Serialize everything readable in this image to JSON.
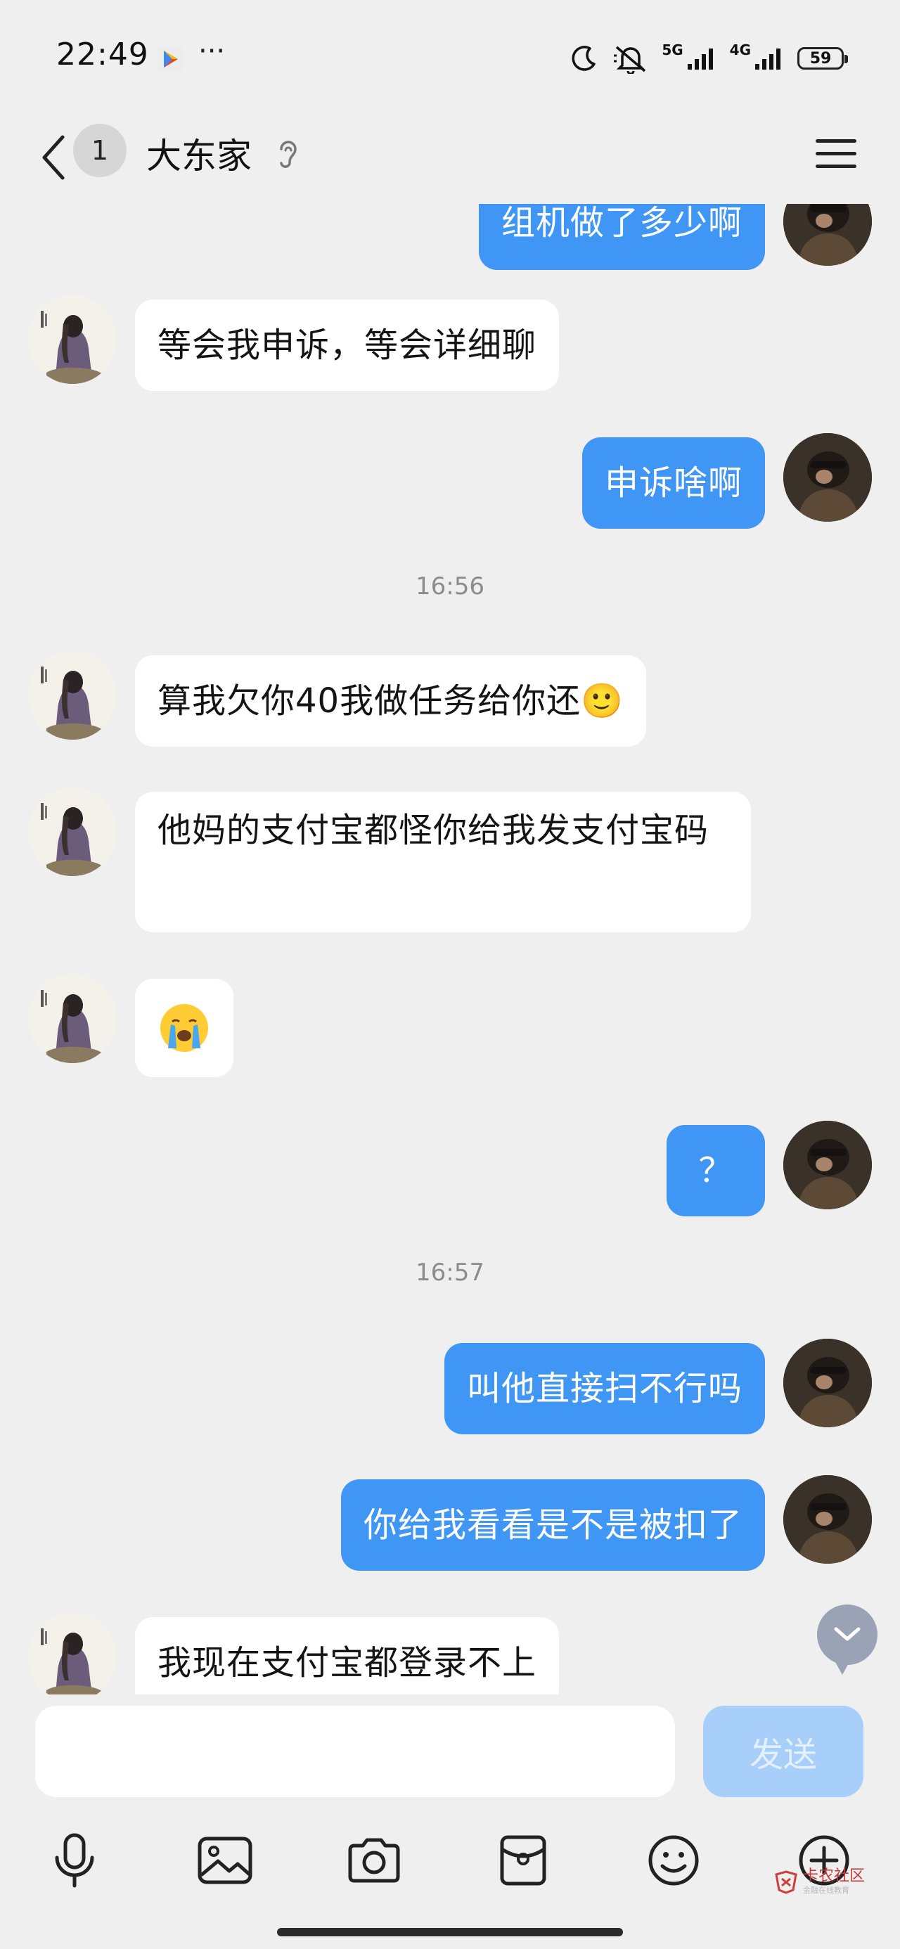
{
  "status_bar": {
    "time": "22:49",
    "more": "···",
    "network_1": "5G",
    "network_2": "4G",
    "battery": "59"
  },
  "header": {
    "unread_count": "1",
    "title": "大东家"
  },
  "messages": [
    {
      "side": "out",
      "text": "组机做了多少啊"
    },
    {
      "side": "in",
      "text": "等会我申诉，等会详细聊"
    },
    {
      "side": "out",
      "text": "申诉啥啊"
    },
    {
      "type": "time",
      "text": "16:56"
    },
    {
      "side": "in",
      "text": "算我欠你40我做任务给你还🙂"
    },
    {
      "side": "in",
      "text": "他妈的支付宝都怪你给我发支付宝码"
    },
    {
      "side": "in",
      "text": "😭"
    },
    {
      "side": "out",
      "text": "？"
    },
    {
      "type": "time",
      "text": "16:57"
    },
    {
      "side": "out",
      "text": "叫他直接扫不行吗"
    },
    {
      "side": "out",
      "text": "你给我看看是不是被扣了"
    },
    {
      "side": "in",
      "text": "我现在支付宝都登录不上"
    }
  ],
  "input": {
    "value": "",
    "send_label": "发送"
  },
  "toolbar_icons": [
    "microphone-icon",
    "image-icon",
    "camera-icon",
    "red-packet-icon",
    "emoji-icon",
    "plus-icon"
  ],
  "watermark": {
    "main": "卡农社区",
    "sub": "金融在线教育"
  },
  "colors": {
    "background": "#efefef",
    "outgoing_bubble": "#3f96f4",
    "incoming_bubble": "#ffffff",
    "send_button_disabled": "#a7cffa"
  }
}
